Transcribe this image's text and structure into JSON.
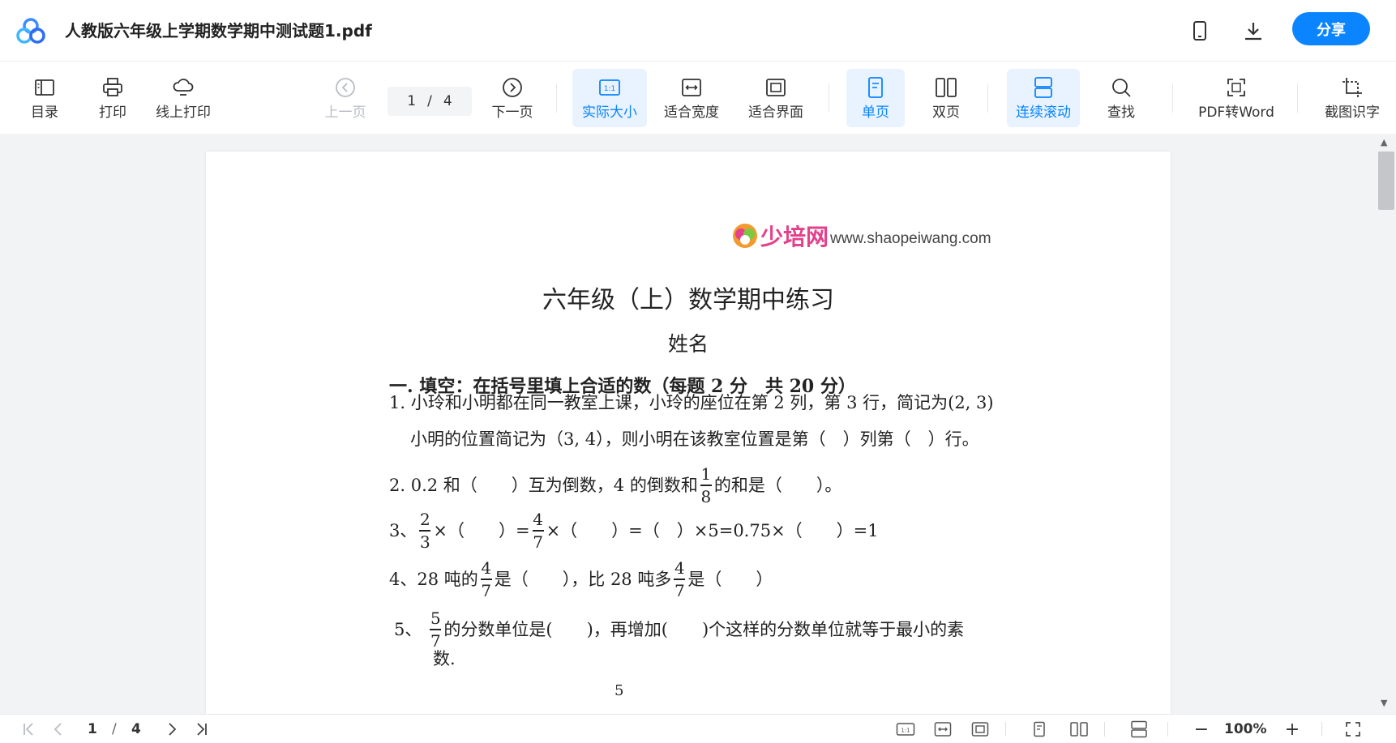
{
  "titlebar": {
    "title": "人教版六年级上学期数学期中测试题1.pdf",
    "share_label": "分享",
    "icons": [
      "app-logo-icon",
      "phone-icon",
      "download-icon"
    ],
    "accent_color": "#0a84ff"
  },
  "toolbar": {
    "toc_label": "目录",
    "print_label": "打印",
    "online_print_label": "线上打印",
    "prev_label": "上一页",
    "page_current": "1",
    "page_sep": "/",
    "page_total": "4",
    "next_label": "下一页",
    "actual_size_label": "实际大小",
    "fit_width_label": "适合宽度",
    "fit_page_label": "适合界面",
    "single_page_label": "单页",
    "double_page_label": "双页",
    "continuous_label": "连续滚动",
    "find_label": "查找",
    "pdf_to_word_label": "PDF转Word",
    "screenshot_ocr_label": "截图识字",
    "actual_size_icon_text": "1:1"
  },
  "document": {
    "brand": "少培网",
    "url": "www.shaopeiwang.com",
    "title": "六年级（上）数学期中练习",
    "name_label": "姓名",
    "section": "一. 填空：在括号里填上合适的数（每题 2 分　共 20 分）",
    "q1_line1": "1. 小玲和小明都在同一教室上课，小玲的座位在第 2 列，第 3 行，简记为(2, 3)",
    "q1_line2": "小明的位置简记为（3, 4），则小明在该教室位置是第（　）列第（　）行。",
    "q2_a": "2. 0.2 和（　　）互为倒数，4 的倒数和",
    "q2_frac_num": "1",
    "q2_frac_den": "8",
    "q2_b": "的和是（　　）。",
    "q3_a": "3、",
    "q3_f1_num": "2",
    "q3_f1_den": "3",
    "q3_b": "×（　　）=",
    "q3_f2_num": "4",
    "q3_f2_den": "7",
    "q3_c": "×（　　）=（　）×5=0.75×（　　）=1",
    "q4_a": "4、28 吨的",
    "q4_f1_num": "4",
    "q4_f1_den": "7",
    "q4_b": "是（　　），比 28 吨多",
    "q4_f2_num": "4",
    "q4_f2_den": "7",
    "q4_c": "是（　　）",
    "q5_a": "5、",
    "q5_f_num": "5",
    "q5_f_den": "7",
    "q5_b": "的分数单位是(　　)，再增加(　　)个这样的分数单位就等于最小的素",
    "q5_line2": "数.",
    "q6_partial": "5"
  },
  "statusbar": {
    "page_current": "1",
    "page_sep": "/",
    "page_total": "4",
    "zoom": "100%",
    "minus": "−",
    "plus": "+"
  }
}
